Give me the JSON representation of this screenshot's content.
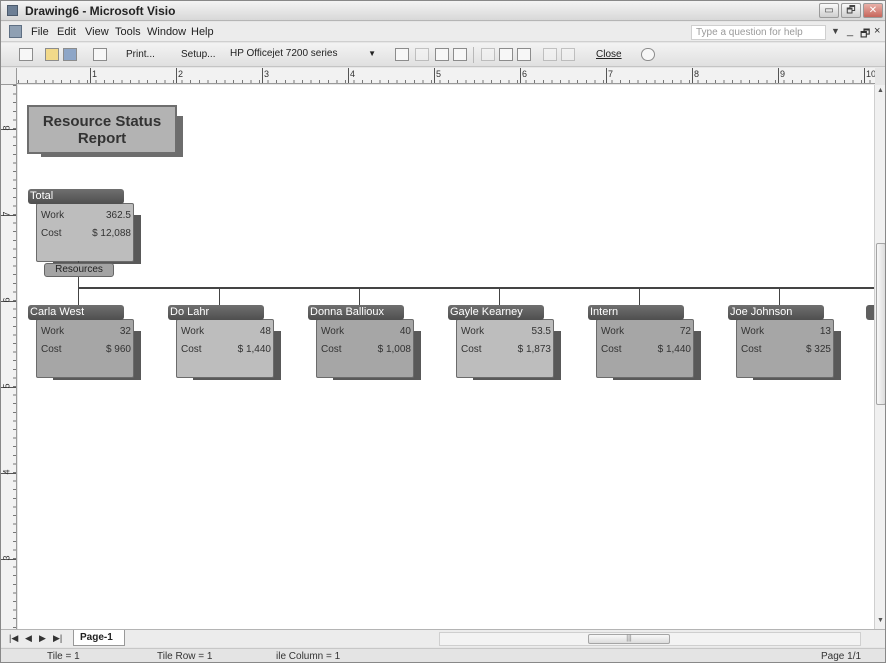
{
  "window": {
    "title": "Drawing6 - Microsoft Visio",
    "controls": {
      "minimize": "▭",
      "restore": "🗗",
      "close": "✕"
    }
  },
  "menu": {
    "items": [
      "File",
      "Edit",
      "View",
      "Tools",
      "Window",
      "Help"
    ],
    "help_placeholder": "Type a question for help",
    "mdi": {
      "minimize": "_",
      "restore": "🗗",
      "close": "×"
    }
  },
  "toolbar": {
    "print_label": "Print...",
    "setup_label": "Setup...",
    "printer": "HP Officejet 7200 series",
    "close_label": "Close"
  },
  "ruler": {
    "h_labels": [
      "1",
      "2",
      "3",
      "4",
      "5",
      "6",
      "7",
      "8",
      "9",
      "10"
    ],
    "v_labels": [
      "8",
      "7",
      "6",
      "5",
      "4",
      "3"
    ]
  },
  "report": {
    "title_line1": "Resource Status",
    "title_line2": "Report"
  },
  "total": {
    "header": "Total",
    "work_label": "Work",
    "work": "362.5",
    "cost_label": "Cost",
    "cost": "$ 12,088"
  },
  "resources_label": "Resources",
  "resources": [
    {
      "name": "Carla West",
      "work_label": "Work",
      "work": "32",
      "cost_label": "Cost",
      "cost": "$ 960"
    },
    {
      "name": "Do Lahr",
      "work_label": "Work",
      "work": "48",
      "cost_label": "Cost",
      "cost": "$ 1,440"
    },
    {
      "name": "Donna Ballioux",
      "work_label": "Work",
      "work": "40",
      "cost_label": "Cost",
      "cost": "$ 1,008"
    },
    {
      "name": "Gayle Kearney",
      "work_label": "Work",
      "work": "53.5",
      "cost_label": "Cost",
      "cost": "$ 1,873"
    },
    {
      "name": "Intern",
      "work_label": "Work",
      "work": "72",
      "cost_label": "Cost",
      "cost": "$ 1,440"
    },
    {
      "name": "Joe Johnson",
      "work_label": "Work",
      "work": "13",
      "cost_label": "Cost",
      "cost": "$ 325"
    }
  ],
  "pages": {
    "nav": {
      "first": "|◀",
      "prev": "◀",
      "next": "▶",
      "last": "▶|"
    },
    "tab": "Page-1"
  },
  "status": {
    "tile": "Tile = 1",
    "tile_row": "Tile Row = 1",
    "tile_column": "ile Column = 1",
    "page": "Page 1/1"
  }
}
